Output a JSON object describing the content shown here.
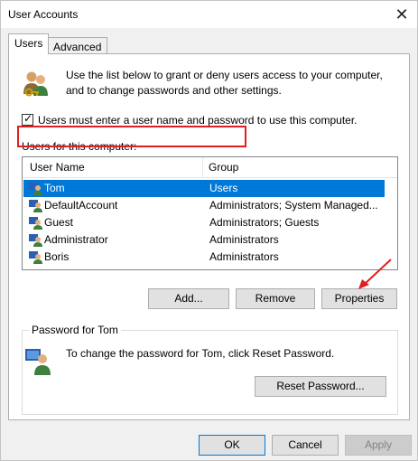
{
  "window": {
    "title": "User Accounts",
    "close_glyph": "✕"
  },
  "tabs": [
    {
      "label": "Users",
      "active": true
    },
    {
      "label": "Advanced",
      "active": false
    }
  ],
  "users_tab": {
    "intro_line1": "Use the list below to grant or deny users access to your computer,",
    "intro_line2": "and to change passwords and other settings.",
    "checkbox_label": "Users must enter a user name and password to use this computer.",
    "checkbox_checked": true,
    "list_label": "Users for this computer:",
    "columns": [
      "User Name",
      "Group"
    ],
    "rows": [
      {
        "name": "Tom",
        "group": "Users",
        "selected": true
      },
      {
        "name": "DefaultAccount",
        "group": "Administrators; System Managed...",
        "selected": false
      },
      {
        "name": "Guest",
        "group": "Administrators; Guests",
        "selected": false
      },
      {
        "name": "Administrator",
        "group": "Administrators",
        "selected": false
      },
      {
        "name": "Boris",
        "group": "Administrators",
        "selected": false
      }
    ],
    "buttons": {
      "add": "Add...",
      "remove": "Remove",
      "properties": "Properties"
    }
  },
  "password_group": {
    "legend": "Password for Tom",
    "text": "To change the password for Tom, click Reset Password.",
    "reset_button": "Reset Password..."
  },
  "footer": {
    "ok": "OK",
    "cancel": "Cancel",
    "apply": "Apply"
  },
  "icons": {
    "users": "users-icon",
    "user": "user-icon",
    "password_user": "password-user-icon",
    "close": "close-icon",
    "annotation_arrow": "arrow-icon"
  },
  "colors": {
    "selection": "#0078d7",
    "annotation": "#e02020",
    "panel_bg": "#ffffff",
    "window_bg": "#f0f0f0"
  }
}
